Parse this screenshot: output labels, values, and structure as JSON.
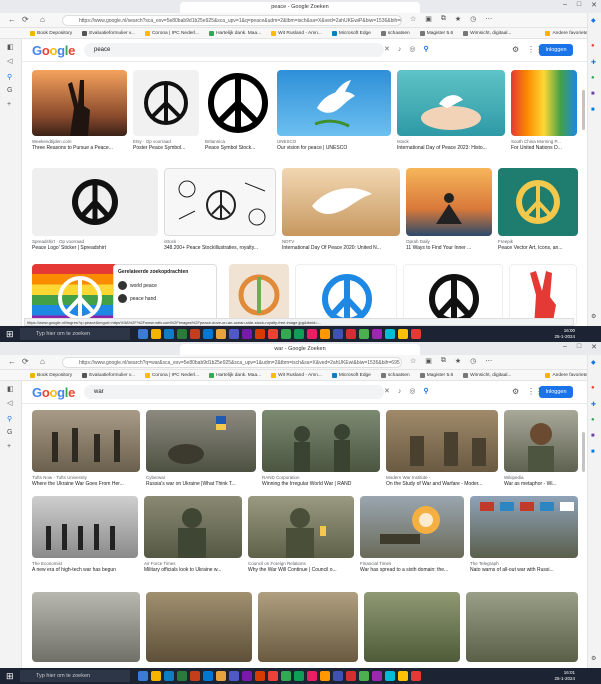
{
  "shot1": {
    "tab_title": "peace - Google Zoeken",
    "url": "https://www.google.nl/search?sca_esv=5e80bab9d1b25e925&sca_upv=1&q=peace&udm=2&tbm=isch&sa=X&ved=2ahUKEwiP&biw=1536&bih=695",
    "query": "peace",
    "login_label": "Inloggen",
    "bookmarks": [
      "Book Depository",
      "Evaluatieformulier v...",
      "Corona | IPC Nederl...",
      "Hartelijk dank. Maa...",
      "Wit Rusland - Amn...",
      "Microsoft Edge",
      "schaatsen",
      "Magister 5.6",
      "Wimsicht, digitaal...",
      "Andere favorieten"
    ],
    "results": [
      {
        "src": "Weekendtijden.com",
        "title": "Three Reasons to Pursue a Peace..."
      },
      {
        "src": "Etsy · Op voorraad",
        "title": "Poster Peace Symbol..."
      },
      {
        "src": "Britannica",
        "title": "Peace Symbol Stock..."
      },
      {
        "src": "UNESCO",
        "title": "Our vision for peace | UNESCO"
      },
      {
        "src": "Istock",
        "title": "International Day of Peace 2023: Histo..."
      },
      {
        "src": "South China Morning P...",
        "title": "For United Nations D..."
      },
      {
        "src": "Spreadshirt · Op voorraad",
        "title": "Peace Logo' Sticker | Spreadshirt"
      },
      {
        "src": "iStock",
        "title": "348.200+ Peace Stockillustraties, royalty..."
      },
      {
        "src": "NDTV",
        "title": "International Day Of Peace 2020: United N..."
      },
      {
        "src": "Oprah Daily",
        "title": "11 Ways to Find Your Inner ..."
      },
      {
        "src": "Freepik",
        "title": "Peace Vector Art, Icons, an..."
      }
    ],
    "related_box": {
      "heading": "Gerelateerde zoekopdrachten",
      "items": [
        "world peace",
        "peace hand"
      ]
    },
    "status_url": "https://www.google.nl/imgres?q=peace&imgurl=https%3A%2F%2Fwww.ndtv.com%2Fimages%2Fpeace-dove-on-an-ocean-side-stock-royalty-free-image.jpg&tbnid=...",
    "taskbar_search": "Typ hier om te zoeken",
    "clock": "16:00",
    "date": "25-1-2024"
  },
  "shot2": {
    "tab_title": "war - Google Zoeken",
    "url": "https://www.google.nl/search?q=war&sca_esv=5e80bab9d1b25e925&sca_upv=1&udm=2&tbm=isch&sa=X&ved=2ahUKEwi&biw=1536&bih=695",
    "query": "war",
    "login_label": "Inloggen",
    "bookmarks": [
      "Book Depository",
      "Evaluatieformulier v...",
      "Corona | IPC Nederl...",
      "Hartelijk dank. Maa...",
      "Wit Rusland - Amn...",
      "Microsoft Edge",
      "schaatsen",
      "Magister 5.6",
      "Wimsicht, digitaal...",
      "Andere favorieten"
    ],
    "results": [
      {
        "src": "Tufts Now - Tufts University",
        "title": "Where the Ukraine War Goes From Her..."
      },
      {
        "src": "Cyberwar",
        "title": "Russia's war on Ukraine |What Think T..."
      },
      {
        "src": "RAND Corporation",
        "title": "Winning the Irregular World War | RAND"
      },
      {
        "src": "Modern War Institute -",
        "title": "On the Study of War and Warfare - Moder..."
      },
      {
        "src": "Wikipedia",
        "title": "War as metaphor - Wi..."
      },
      {
        "src": "The Economist",
        "title": "A new era of high-tech war has begun"
      },
      {
        "src": "Air Force Times",
        "title": "Military officials look to Ukraine w..."
      },
      {
        "src": "Council on Foreign Relations",
        "title": "Why the War Will Continue | Council o..."
      },
      {
        "src": "Financial Times",
        "title": "War has spread to a sixth domain: the..."
      },
      {
        "src": "The Telegraph",
        "title": "Nato warns of all-out war with Russi..."
      }
    ],
    "taskbar_search": "Typ hier om te zoeken",
    "clock": "16:01",
    "date": "25-1-2024"
  },
  "brand_colors": {
    "google_blue": "#4285f4",
    "google_red": "#ea4335",
    "google_yellow": "#fbbc05",
    "google_green": "#34a853",
    "login_button": "#1a73e8",
    "taskbar": "#1c2433"
  },
  "icons": [
    "back-icon",
    "forward-icon",
    "refresh-icon",
    "home-icon",
    "lock-icon",
    "star-icon",
    "settings-icon",
    "apps-icon",
    "search-icon",
    "mic-icon",
    "lens-icon",
    "close-icon",
    "windows-icon",
    "peace-sign-icon"
  ]
}
